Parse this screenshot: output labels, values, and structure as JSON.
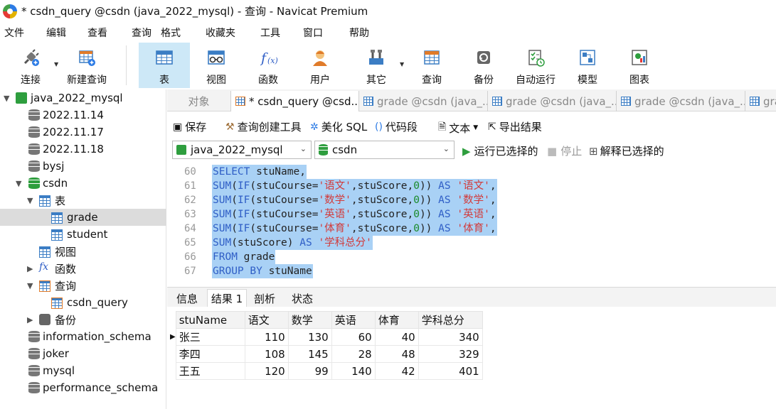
{
  "window": {
    "title": "* csdn_query @csdn (java_2022_mysql) - 查询 - Navicat Premium"
  },
  "menu": [
    "文件",
    "编辑",
    "查看",
    "查询",
    "格式",
    "收藏夹",
    "工具",
    "窗口",
    "帮助"
  ],
  "toolbar": {
    "connect": "连接",
    "new_query": "新建查询",
    "table": "表",
    "view": "视图",
    "function": "函数",
    "user": "用户",
    "other": "其它",
    "query": "查询",
    "backup": "备份",
    "automation": "自动运行",
    "model": "模型",
    "chart": "图表"
  },
  "tree": {
    "connection": "java_2022_mysql",
    "db1": "2022.11.14",
    "db2": "2022.11.17",
    "db3": "2022.11.18",
    "db4": "bysj",
    "db5": "csdn",
    "tables_node": "表",
    "table1": "grade",
    "table2": "student",
    "views_node": "视图",
    "functions_node": "函数",
    "queries_node": "查询",
    "query1": "csdn_query",
    "backups_node": "备份",
    "db6": "information_schema",
    "db7": "joker",
    "db8": "mysql",
    "db9": "performance_schema"
  },
  "tabs": {
    "objects": "对象",
    "t1": "* csdn_query @csd...",
    "t2": "grade @csdn (java_...",
    "t3": "grade @csdn (java_...",
    "t4": "grade @csdn (java_...",
    "t5": "gra"
  },
  "query_toolbar": {
    "save": "保存",
    "builder": "查询创建工具",
    "beautify": "美化 SQL",
    "snippet": "代码段",
    "text": "文本",
    "export": "导出结果"
  },
  "selectors": {
    "connection": "java_2022_mysql",
    "database": "csdn",
    "run_selected": "运行已选择的",
    "stop": "停止",
    "explain": "解释已选择的"
  },
  "editor": {
    "lines": [
      {
        "n": "60",
        "text": "SELECT stuName,"
      },
      {
        "n": "61",
        "text": "SUM(IF(stuCourse='语文',stuScore,0)) AS '语文',"
      },
      {
        "n": "62",
        "text": "SUM(IF(stuCourse='数学',stuScore,0)) AS '数学',"
      },
      {
        "n": "63",
        "text": "SUM(IF(stuCourse='英语',stuScore,0)) AS '英语',"
      },
      {
        "n": "64",
        "text": "SUM(IF(stuCourse='体育',stuScore,0)) AS '体育',"
      },
      {
        "n": "65",
        "text": "SUM(stuScore) AS '学科总分'"
      },
      {
        "n": "66",
        "text": "FROM grade"
      },
      {
        "n": "67",
        "text": "GROUP BY stuName"
      }
    ]
  },
  "result_tabs": {
    "info": "信息",
    "result1": "结果 1",
    "profile": "剖析",
    "status": "状态"
  },
  "results": {
    "columns": [
      "stuName",
      "语文",
      "数学",
      "英语",
      "体育",
      "学科总分"
    ],
    "rows": [
      [
        "张三",
        "110",
        "130",
        "60",
        "40",
        "340"
      ],
      [
        "李四",
        "108",
        "145",
        "28",
        "48",
        "329"
      ],
      [
        "王五",
        "120",
        "99",
        "140",
        "42",
        "401"
      ]
    ]
  }
}
